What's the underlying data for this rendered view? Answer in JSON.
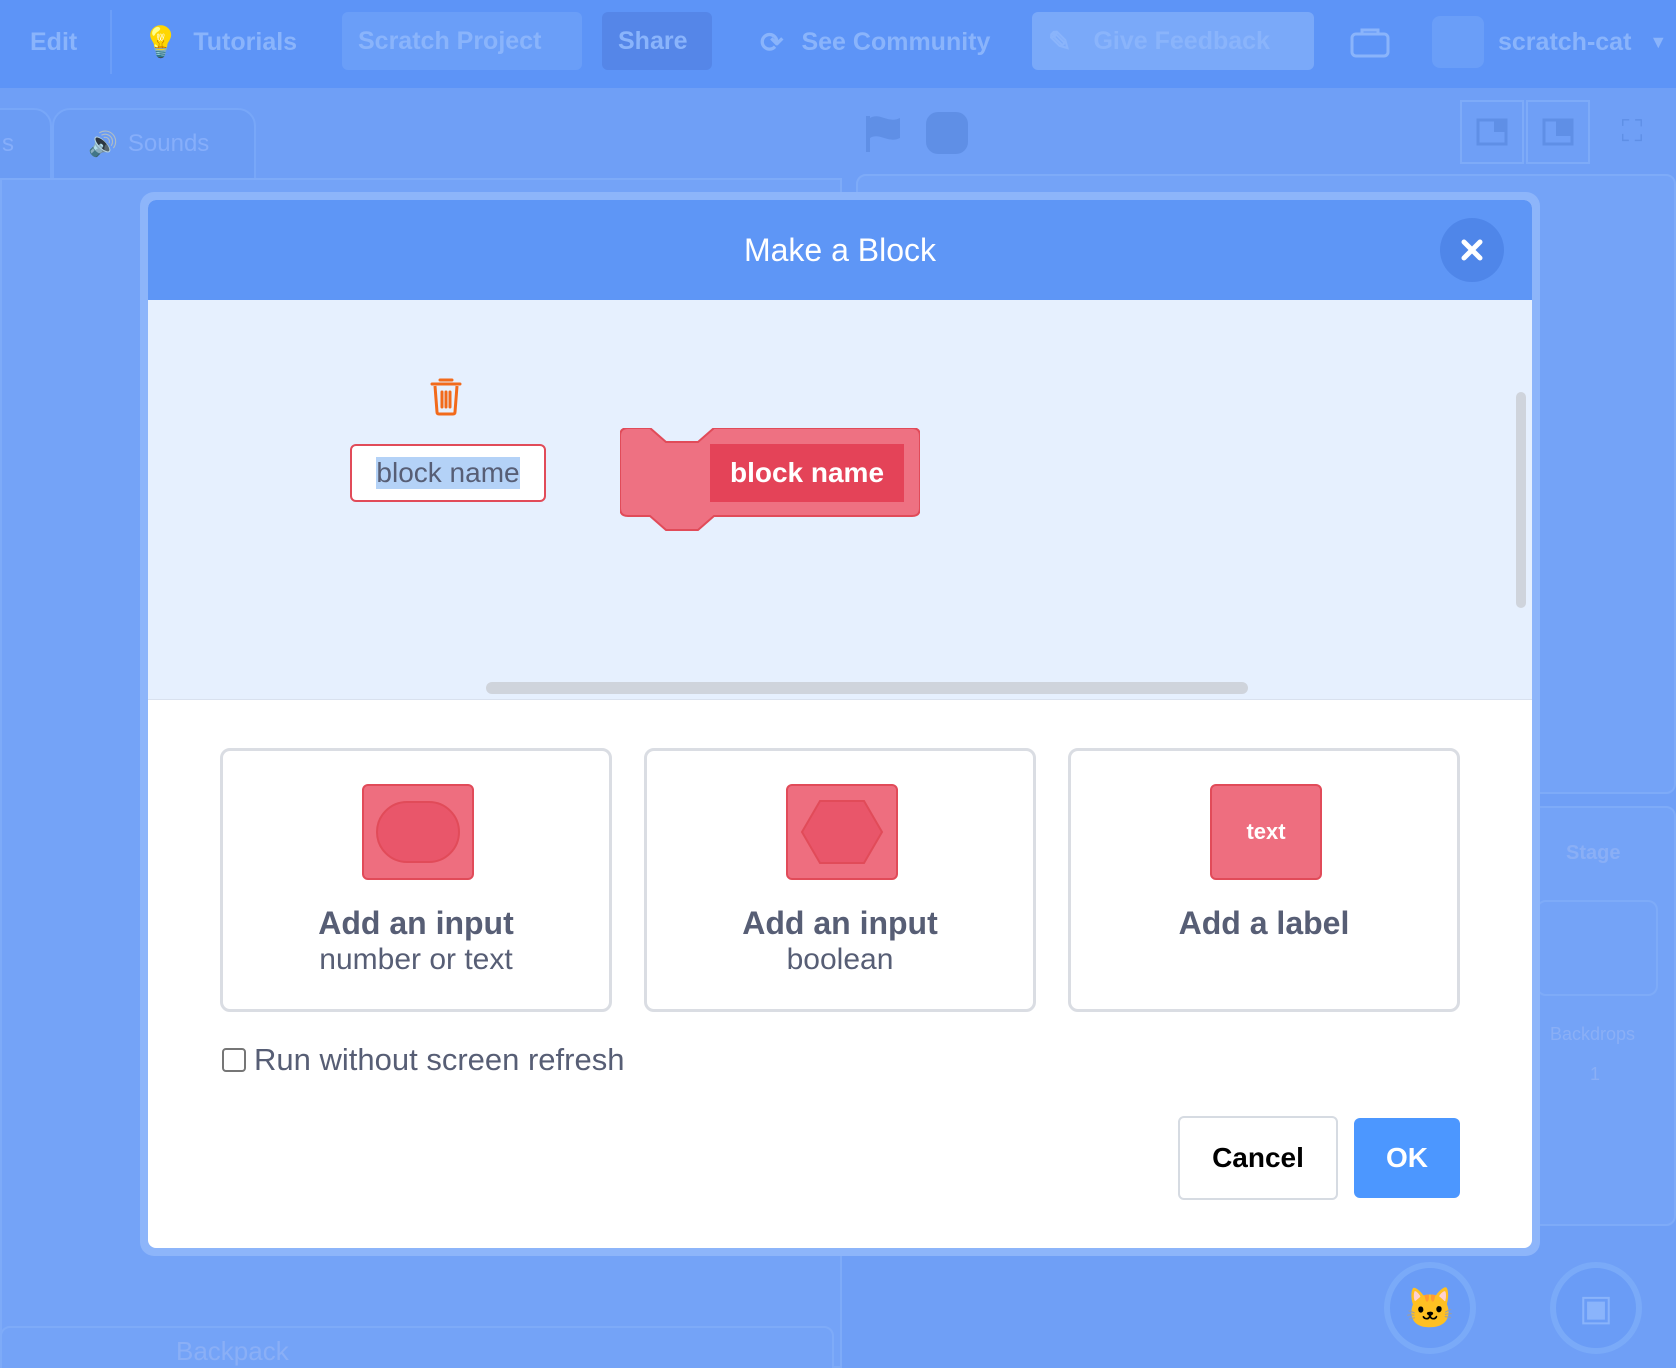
{
  "menubar": {
    "edit_label": "Edit",
    "tutorials_label": "Tutorials",
    "project_title": "Scratch Project",
    "share_label": "Share",
    "see_community_label": "See Community",
    "give_feedback_label": "Give Feedback",
    "username": "scratch-cat"
  },
  "background": {
    "tab_costumes_partial": "s",
    "tab_sounds_label": "Sounds",
    "stage_label": "Stage",
    "backdrops_label": "Backdrops",
    "backdrops_count": "1",
    "backpack_label": "Backpack"
  },
  "modal": {
    "title": "Make a Block",
    "block_name_value": "block name",
    "block_preview_label": "block name",
    "options": [
      {
        "title": "Add an input",
        "subtitle": "number or text"
      },
      {
        "title": "Add an input",
        "subtitle": "boolean"
      },
      {
        "title": "Add a label",
        "subtitle": "",
        "icon_text": "text"
      }
    ],
    "run_without_refresh_label": "Run without screen refresh",
    "run_without_refresh_checked": false,
    "cancel_label": "Cancel",
    "ok_label": "OK"
  },
  "colors": {
    "header_blue": "#5e96f6",
    "custom_block_red": "#e44358",
    "ok_blue": "#4c97ff"
  }
}
